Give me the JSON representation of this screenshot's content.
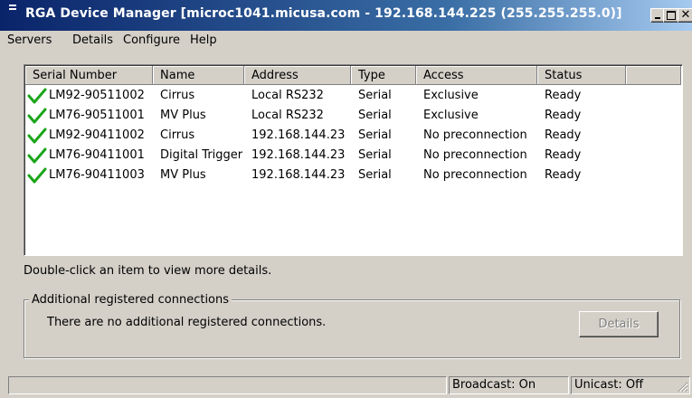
{
  "window": {
    "title": "RGA Device Manager [microc1041.micusa.com - 192.168.144.225 (255.255.255.0)]",
    "app_icon": "app-icon",
    "controls": {
      "minimize": "minimize-icon",
      "maximize": "maximize-icon",
      "close": "close-icon"
    }
  },
  "menu": {
    "items": [
      {
        "label": "Servers"
      },
      {
        "label": "Details"
      },
      {
        "label": "Configure"
      },
      {
        "label": "Help"
      }
    ]
  },
  "device_list": {
    "columns": [
      {
        "label": "Serial Number"
      },
      {
        "label": "Name"
      },
      {
        "label": "Address"
      },
      {
        "label": "Type"
      },
      {
        "label": "Access"
      },
      {
        "label": "Status"
      },
      {
        "label": ""
      }
    ],
    "rows": [
      {
        "status_icon": "green-checkmark-icon",
        "serial": "LM92-90511002",
        "name": "Cirrus",
        "address": "Local RS232",
        "type": "Serial",
        "access": "Exclusive",
        "status": "Ready"
      },
      {
        "status_icon": "green-checkmark-icon",
        "serial": "LM76-90511001",
        "name": "MV Plus",
        "address": "Local RS232",
        "type": "Serial",
        "access": "Exclusive",
        "status": "Ready"
      },
      {
        "status_icon": "green-checkmark-icon",
        "serial": "LM92-90411002",
        "name": "Cirrus",
        "address": "192.168.144.23",
        "type": "Serial",
        "access": "No preconnection",
        "status": "Ready"
      },
      {
        "status_icon": "green-checkmark-icon",
        "serial": "LM76-90411001",
        "name": "Digital Trigger",
        "address": "192.168.144.23",
        "type": "Serial",
        "access": "No preconnection",
        "status": "Ready"
      },
      {
        "status_icon": "green-checkmark-icon",
        "serial": "LM76-90411003",
        "name": "MV Plus",
        "address": "192.168.144.23",
        "type": "Serial",
        "access": "No preconnection",
        "status": "Ready"
      }
    ]
  },
  "hint": "Double-click an item to view more details.",
  "additional": {
    "group_label": "Additional registered connections",
    "message": "There are no additional registered connections.",
    "details_button": "Details"
  },
  "statusbar": {
    "main": "",
    "broadcast": "Broadcast: On",
    "unicast": "Unicast: Off"
  },
  "colors": {
    "check": "#1aa51a",
    "title_gradient_start": "#0a246a",
    "title_gradient_end": "#a6caf0"
  }
}
